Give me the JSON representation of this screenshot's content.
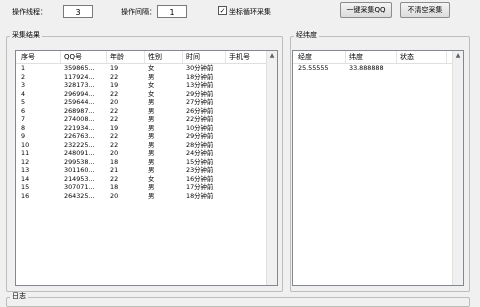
{
  "toolbar": {
    "threads_label": "操作线程：",
    "threads_value": "3",
    "interval_label": "操作间隔：",
    "interval_value": "1",
    "loop_label": "坐标循环采集",
    "loop_checked": "✓",
    "collect_button": "一键采集QQ",
    "clear_button": "不清空采集"
  },
  "results": {
    "title": "采集结果",
    "columns": [
      "序号",
      "QQ号",
      "年龄",
      "性别",
      "时间",
      "手机号"
    ],
    "rows": [
      [
        "1",
        "359865...",
        "19",
        "女",
        "30分钟前",
        ""
      ],
      [
        "2",
        "117924...",
        "22",
        "男",
        "18分钟前",
        ""
      ],
      [
        "3",
        "328173...",
        "19",
        "女",
        "13分钟前",
        ""
      ],
      [
        "4",
        "296994...",
        "22",
        "女",
        "29分钟前",
        ""
      ],
      [
        "5",
        "259644...",
        "20",
        "男",
        "27分钟前",
        ""
      ],
      [
        "6",
        "268987...",
        "22",
        "男",
        "26分钟前",
        ""
      ],
      [
        "7",
        "274008...",
        "22",
        "男",
        "22分钟前",
        ""
      ],
      [
        "8",
        "221934...",
        "19",
        "男",
        "10分钟前",
        ""
      ],
      [
        "9",
        "226763...",
        "22",
        "男",
        "29分钟前",
        ""
      ],
      [
        "10",
        "232225...",
        "22",
        "男",
        "28分钟前",
        ""
      ],
      [
        "11",
        "248091...",
        "20",
        "男",
        "24分钟前",
        ""
      ],
      [
        "12",
        "299538...",
        "18",
        "男",
        "15分钟前",
        ""
      ],
      [
        "13",
        "301160...",
        "21",
        "男",
        "23分钟前",
        ""
      ],
      [
        "14",
        "214953...",
        "22",
        "女",
        "16分钟前",
        ""
      ],
      [
        "15",
        "307071...",
        "18",
        "男",
        "17分钟前",
        ""
      ],
      [
        "16",
        "264325...",
        "20",
        "男",
        "18分钟前",
        ""
      ]
    ]
  },
  "coords": {
    "title": "经纬度",
    "columns": [
      "经度",
      "纬度",
      "状态"
    ],
    "rows": [
      [
        "25.55555",
        "33.888888",
        ""
      ]
    ]
  },
  "log": {
    "title": "日志"
  }
}
